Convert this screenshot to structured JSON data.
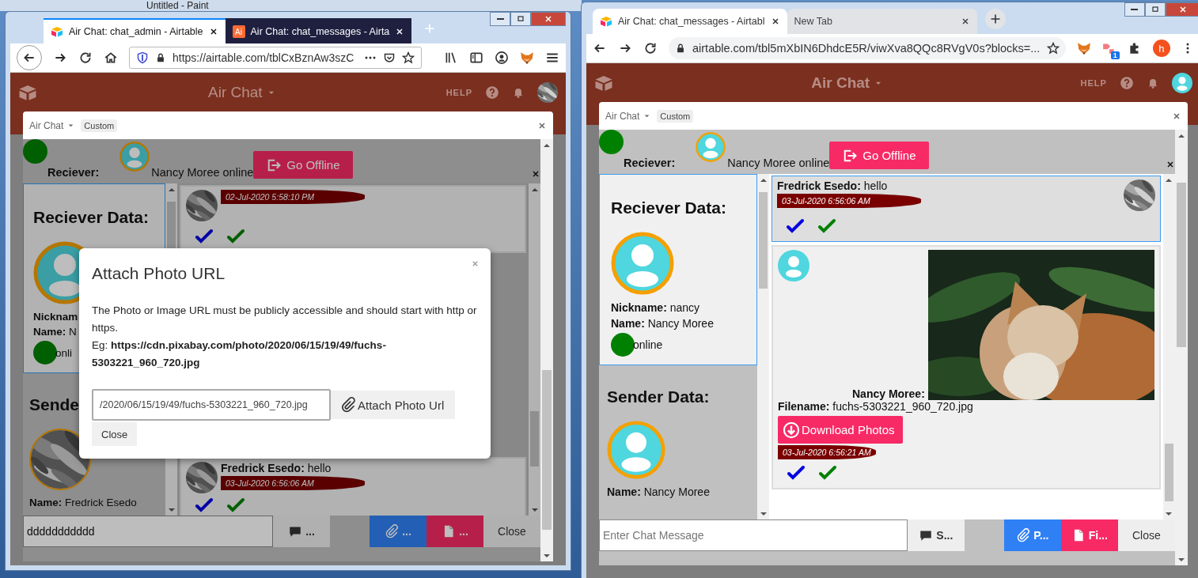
{
  "background_window": {
    "title": "Untitled - Paint"
  },
  "windows": [
    {
      "kind": "firefox",
      "tabs": [
        {
          "title": "Air Chat: chat_admin - Airtable",
          "selected": true,
          "kind": "logo"
        },
        {
          "title": "Air Chat: chat_messages - Airta",
          "selected": false,
          "kind": "letters",
          "icon_label": "Ai"
        }
      ],
      "address": "https://airtable.com/tblCxBznAw3szC",
      "app": {
        "title": "Air Chat",
        "help": "HELP",
        "block": {
          "name": "Air Chat",
          "badge": "Custom"
        },
        "receiver_bar": {
          "label": "Reciever:",
          "status": "Nancy Moree online",
          "button": "Go Offline"
        },
        "receiver_card": {
          "heading": "Reciever Data:",
          "fields": [
            {
              "label": "Nicknam"
            },
            {
              "label": "Name:",
              "value": "N"
            }
          ],
          "status": "onli"
        },
        "sender_card": {
          "heading": "Sende",
          "fields": [
            {
              "label": "Name:",
              "value": "Fredrick Esedo"
            }
          ]
        },
        "messages": [
          {
            "kind": "text",
            "selected": false,
            "time": "02-Jul-2020 5:58:10 PM"
          },
          {
            "kind": "text",
            "selected": false,
            "sender": "Fredrick Esedo:",
            "text": "hello",
            "time": "03-Jul-2020 6:56:06 AM"
          }
        ],
        "composer": {
          "value": "ddddddddddd",
          "buttons": [
            {
              "kind": "send",
              "label": "..."
            },
            {
              "label": "..."
            },
            {
              "kind": "file",
              "label": "..."
            },
            {
              "kind": "close",
              "label": "Close"
            }
          ]
        }
      },
      "modal": {
        "title": "Attach Photo URL",
        "text": "The Photo or Image URL must be publicly accessible and should start with http or https.",
        "example": "Eg: **https://cdn.pixabay.com/photo/2020/06/15/19/49/fuchs-5303221_960_720.jpg**",
        "url_value": "/2020/06/15/19/49/fuchs-5303221_960_720.jpg",
        "attach_button": "Attach Photo Url",
        "close_button": "Close"
      }
    },
    {
      "kind": "chrome",
      "tabs": [
        {
          "title": "Air Chat: chat_messages - Airtabl",
          "selected": true,
          "kind": "logo"
        },
        {
          "title": "New Tab",
          "selected": false,
          "kind": "plain"
        }
      ],
      "address": "airtable.com/tbl5mXbIN6DhdcE5R/viwXva8QQc8RVgV0s?blocks=...",
      "extension_badge": "1",
      "profile_initial": "h",
      "app": {
        "title": "Air Chat",
        "help": "HELP",
        "account": {
          "kind": "person"
        },
        "block": {
          "name": "Air Chat",
          "badge": "Custom"
        },
        "receiver_bar": {
          "label": "Reciever:",
          "status": "Nancy Moree online",
          "button": "Go Offline"
        },
        "receiver_card": {
          "heading": "Reciever Data:",
          "fields": [
            {
              "label": "Nickname:",
              "value": "nancy"
            },
            {
              "label": "Name:",
              "value": "Nancy Moree"
            }
          ],
          "status": "online"
        },
        "sender_card": {
          "heading": "Sender Data:",
          "avatar": {
            "kind": "person"
          },
          "fields": [
            {
              "label": "Name:",
              "value": "Nancy Moree"
            }
          ]
        },
        "messages": [
          {
            "kind": "own_text",
            "selected": true,
            "sender": "Fredrick Esedo:",
            "text": "hello",
            "time": "03-Jul-2020 6:56:06 AM"
          },
          {
            "selected": false,
            "avatar": {
              "kind": "person"
            },
            "caption": "Nancy Moree:",
            "file_label": "Filename:",
            "file_name": "fuchs-5303221_960_720.jpg",
            "button": "Download Photos",
            "time": "03-Jul-2020 6:56:21 AM"
          }
        ],
        "composer": {
          "placeholder": "Enter Chat Message",
          "buttons": [
            {
              "kind": "send",
              "label": "S..."
            },
            {
              "label": "P..."
            },
            {
              "kind": "file",
              "label": "Fi..."
            },
            {
              "kind": "close",
              "label": "Close"
            }
          ]
        }
      }
    }
  ]
}
